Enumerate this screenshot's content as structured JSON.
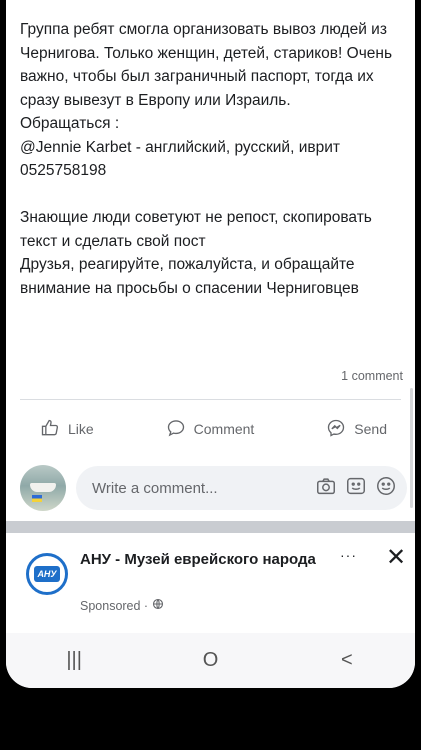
{
  "post": {
    "text": "Группа ребят смогла организовать вывоз людей из Чернигова. Только женщин, детей, стариков! Очень важно, чтобы был заграничный паспорт, тогда их сразу вывезут в Европу или Израиль.\nОбращаться :\n@Jennie Karbet - английский, русский, иврит\n0525758198\n\nЗнающие люди советуют не репост, скопировать текст и сделать свой пост\nДрузья, реагируйте, пожалуйста, и обращайте внимание на просьбы о спасении Черниговцев",
    "comment_count": "1 comment"
  },
  "actions": {
    "like": "Like",
    "comment": "Comment",
    "send": "Send"
  },
  "comment_box": {
    "placeholder": "Write a comment..."
  },
  "ad": {
    "logo_text": "АНУ",
    "title": "АНУ - Музей еврейского народа",
    "sponsored": "Sponsored ·",
    "more": "···",
    "close": "✕"
  },
  "navbar": {
    "recents": "|||",
    "home": "O",
    "back": "<"
  },
  "colors": {
    "text": "#1c1e21",
    "secondary": "#65676b",
    "input_bg": "#f0f2f5",
    "brand_blue": "#1e6fc9"
  },
  "icons": [
    "like-icon",
    "comment-icon",
    "messenger-icon",
    "camera-icon",
    "gif-icon",
    "emoji-icon",
    "globe-icon"
  ]
}
